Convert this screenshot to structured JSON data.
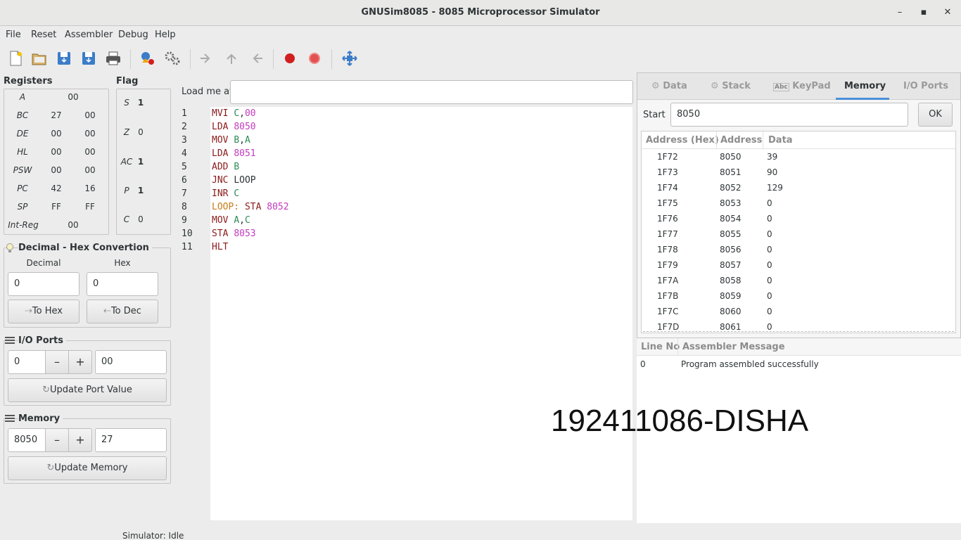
{
  "window": {
    "title": "GNUSim8085 - 8085 Microprocessor Simulator",
    "minimize": "–",
    "maximize": "▪",
    "close": "✕"
  },
  "menu": [
    "File",
    "Reset",
    "Assembler",
    "Debug",
    "Help"
  ],
  "toolbar": {
    "icons": [
      "new-file-icon",
      "open-file-icon",
      "save-icon",
      "save-as-icon",
      "print-icon",
      "assemble-icon",
      "execute-icon",
      "step-in-icon",
      "step-over-icon",
      "step-out-icon",
      "breakpoint-icon",
      "stop-icon",
      "fullscreen-icon"
    ]
  },
  "registers": {
    "title": "Registers",
    "rows": [
      {
        "name": "A",
        "v1": "00",
        "v2": ""
      },
      {
        "name": "BC",
        "v1": "27",
        "v2": "00"
      },
      {
        "name": "DE",
        "v1": "00",
        "v2": "00"
      },
      {
        "name": "HL",
        "v1": "00",
        "v2": "00"
      },
      {
        "name": "PSW",
        "v1": "00",
        "v2": "00"
      },
      {
        "name": "PC",
        "v1": "42",
        "v2": "16"
      },
      {
        "name": "SP",
        "v1": "FF",
        "v2": "FF"
      },
      {
        "name": "Int-Reg",
        "v1": "00",
        "v2": ""
      }
    ]
  },
  "flags": {
    "title": "Flag",
    "rows": [
      {
        "name": "S",
        "v": "1"
      },
      {
        "name": "Z",
        "v": "0"
      },
      {
        "name": "AC",
        "v": "1"
      },
      {
        "name": "P",
        "v": "1"
      },
      {
        "name": "C",
        "v": "0"
      }
    ]
  },
  "converter": {
    "title": "Decimal - Hex Convertion",
    "decimal_label": "Decimal",
    "hex_label": "Hex",
    "decimal_value": "0",
    "hex_value": "0",
    "to_hex": "To Hex",
    "to_dec": "To Dec"
  },
  "io_ports": {
    "title": "I/O Ports",
    "port_value": "0",
    "minus": "–",
    "plus": "+",
    "data_value": "00",
    "update": "Update Port Value"
  },
  "memory_panel": {
    "title": "Memory",
    "address_value": "8050",
    "minus": "–",
    "plus": "+",
    "data_value": "27",
    "update": "Update Memory"
  },
  "loader": {
    "label": "Load me at",
    "value": ""
  },
  "code": [
    {
      "n": "1",
      "parts": [
        [
          "kw",
          "MVI "
        ],
        [
          "reg",
          "C"
        ],
        [
          "plain",
          ","
        ],
        [
          "num",
          "00"
        ]
      ]
    },
    {
      "n": "2",
      "parts": [
        [
          "kw",
          "LDA "
        ],
        [
          "num",
          "8050"
        ]
      ]
    },
    {
      "n": "3",
      "parts": [
        [
          "kw",
          "MOV "
        ],
        [
          "reg",
          "B"
        ],
        [
          "plain",
          ","
        ],
        [
          "reg",
          "A"
        ]
      ]
    },
    {
      "n": "4",
      "parts": [
        [
          "kw",
          "LDA "
        ],
        [
          "num",
          "8051"
        ]
      ]
    },
    {
      "n": "5",
      "parts": [
        [
          "kw",
          "ADD "
        ],
        [
          "reg",
          "B"
        ]
      ]
    },
    {
      "n": "6",
      "parts": [
        [
          "kw",
          "JNC "
        ],
        [
          "plain",
          "LOOP"
        ]
      ]
    },
    {
      "n": "7",
      "parts": [
        [
          "kw",
          "INR "
        ],
        [
          "reg",
          "C"
        ]
      ]
    },
    {
      "n": "8",
      "parts": [
        [
          "lbl",
          "LOOP: "
        ],
        [
          "kw",
          "STA "
        ],
        [
          "num",
          "8052"
        ]
      ]
    },
    {
      "n": "9",
      "parts": [
        [
          "kw",
          "MOV "
        ],
        [
          "reg",
          "A"
        ],
        [
          "plain",
          ","
        ],
        [
          "reg",
          "C"
        ]
      ]
    },
    {
      "n": "10",
      "parts": [
        [
          "kw",
          "STA "
        ],
        [
          "num",
          "8053"
        ]
      ]
    },
    {
      "n": "11",
      "parts": [
        [
          "kw",
          "HLT"
        ]
      ]
    }
  ],
  "tabs": {
    "data": "Data",
    "stack": "Stack",
    "keypad": "KeyPad",
    "memory": "Memory",
    "io": "I/O Ports"
  },
  "memory_view": {
    "start_label": "Start",
    "start_value": "8050",
    "ok": "OK",
    "headers": [
      "Address (Hex)",
      "Address",
      "Data"
    ],
    "rows": [
      [
        "1F72",
        "8050",
        "39"
      ],
      [
        "1F73",
        "8051",
        "90"
      ],
      [
        "1F74",
        "8052",
        "129"
      ],
      [
        "1F75",
        "8053",
        "0"
      ],
      [
        "1F76",
        "8054",
        "0"
      ],
      [
        "1F77",
        "8055",
        "0"
      ],
      [
        "1F78",
        "8056",
        "0"
      ],
      [
        "1F79",
        "8057",
        "0"
      ],
      [
        "1F7A",
        "8058",
        "0"
      ],
      [
        "1F7B",
        "8059",
        "0"
      ],
      [
        "1F7C",
        "8060",
        "0"
      ],
      [
        "1F7D",
        "8061",
        "0"
      ]
    ]
  },
  "messages": {
    "headers": [
      "Line No",
      "Assembler Message"
    ],
    "rows": [
      [
        "0",
        "Program assembled successfully"
      ]
    ]
  },
  "watermark": "192411086-DISHA",
  "status": "Simulator: Idle",
  "colors": {
    "keyword": "#8b1a1a",
    "register": "#2e8b57",
    "number": "#c23bbd",
    "accent": "#4a90d9",
    "breakpoint": "#d11f1f"
  }
}
